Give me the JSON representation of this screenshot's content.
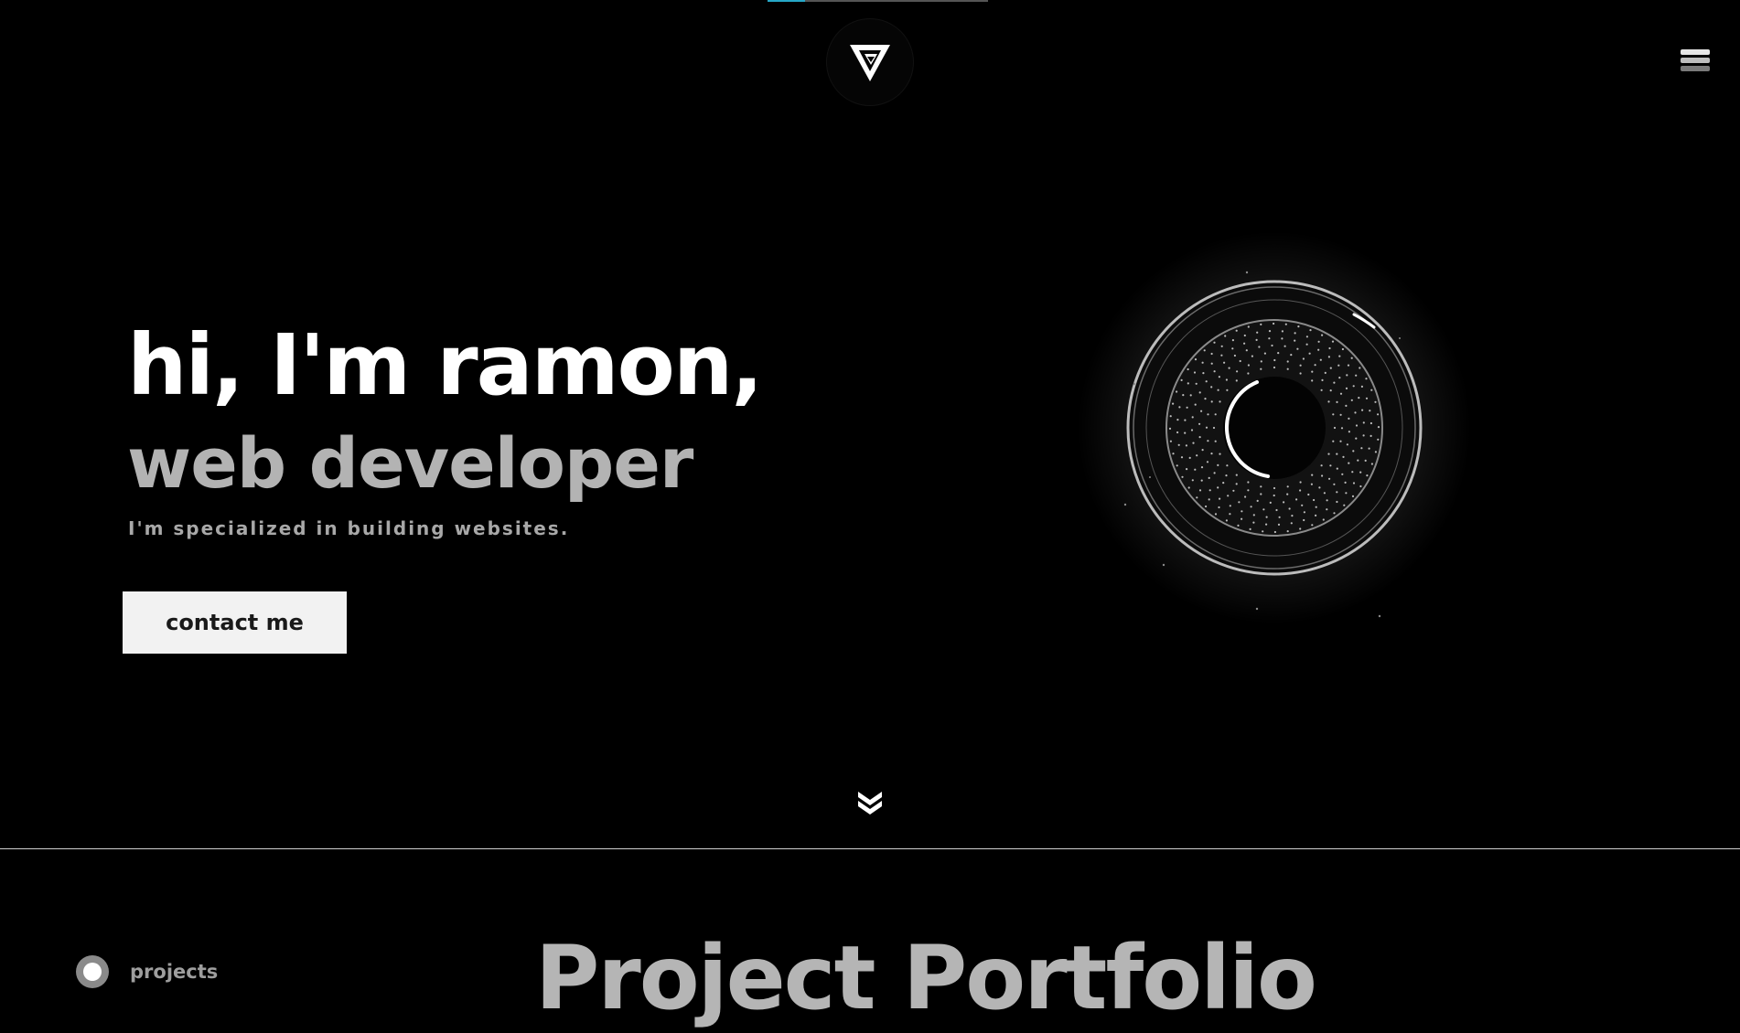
{
  "header": {
    "logo_icon": "triangle-logo-icon",
    "menu_icon": "hamburger-menu-icon",
    "scroll_progress": 0.17,
    "accent_color": "#26a7c7"
  },
  "hero": {
    "greeting": "hi, I'm ramon,",
    "role": "web developer",
    "tagline": "I'm specialized in building websites.",
    "contact_label": "contact me",
    "scroll_icon": "double-chevron-down-icon"
  },
  "section_nav": {
    "active_label": "projects"
  },
  "portfolio": {
    "title": "Project Portfolio"
  }
}
